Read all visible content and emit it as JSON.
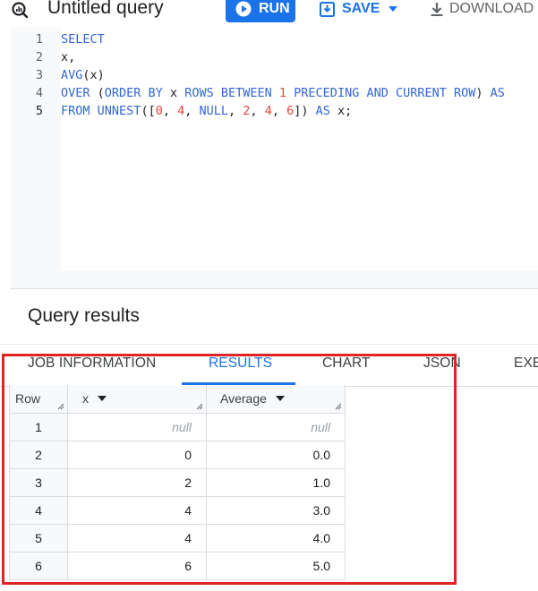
{
  "header": {
    "title": "Untitled query",
    "run_label": "RUN",
    "save_label": "SAVE",
    "download_label": "DOWNLOAD"
  },
  "editor": {
    "line_numbers": [
      "1",
      "2",
      "3",
      "4",
      "5"
    ],
    "active_line": 5
  },
  "results": {
    "title": "Query results",
    "tabs": [
      {
        "label": "JOB INFORMATION",
        "active": false
      },
      {
        "label": "RESULTS",
        "active": true
      },
      {
        "label": "CHART",
        "active": false
      },
      {
        "label": "JSON",
        "active": false
      },
      {
        "label": "EXE",
        "active": false
      }
    ],
    "columns": [
      "Row",
      "x",
      "Average"
    ],
    "rows": [
      {
        "row": "1",
        "x": "null",
        "avg": "null"
      },
      {
        "row": "2",
        "x": "0",
        "avg": "0.0"
      },
      {
        "row": "3",
        "x": "2",
        "avg": "1.0"
      },
      {
        "row": "4",
        "x": "4",
        "avg": "3.0"
      },
      {
        "row": "5",
        "x": "4",
        "avg": "4.0"
      },
      {
        "row": "6",
        "x": "6",
        "avg": "5.0"
      }
    ]
  },
  "colors": {
    "accent": "#1a73e8",
    "keyword": "#3367d6",
    "number": "#e8453c",
    "highlight": "#e02424"
  }
}
